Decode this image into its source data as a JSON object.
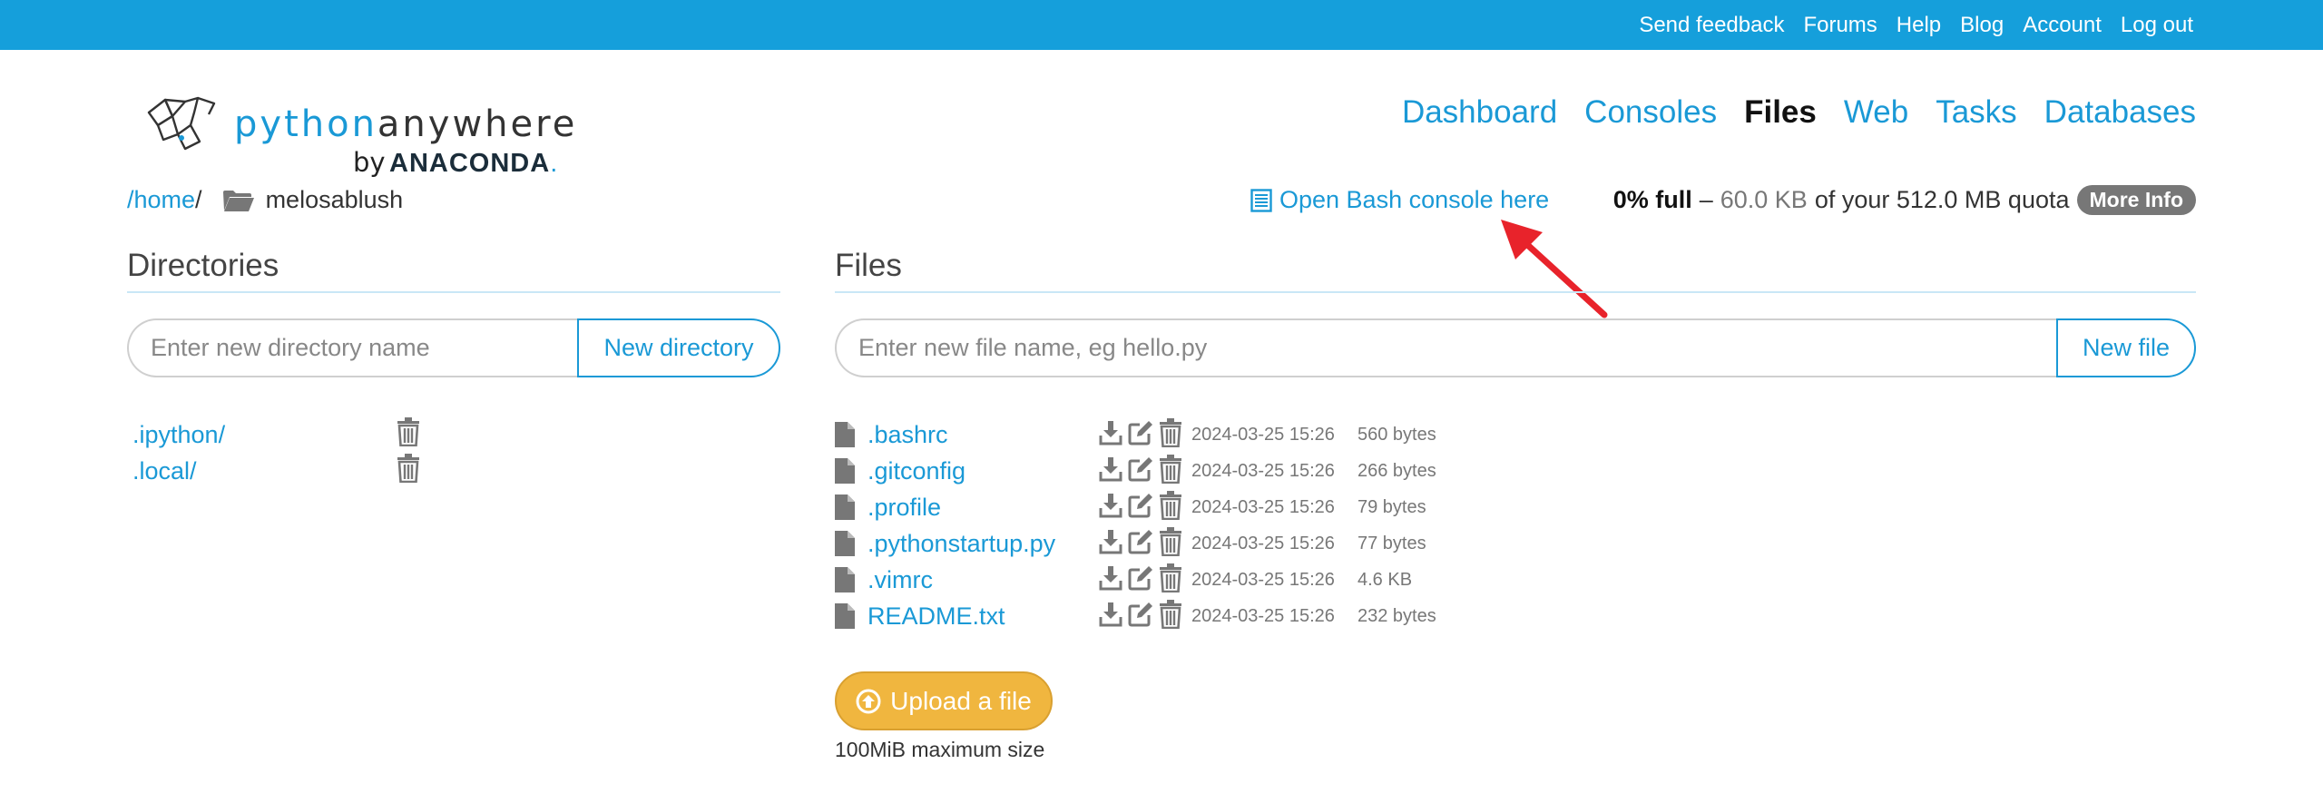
{
  "topbar": {
    "links": [
      "Send feedback",
      "Forums",
      "Help",
      "Blog",
      "Account",
      "Log out"
    ]
  },
  "logo": {
    "word_python": "python",
    "word_anywhere": "anywhere",
    "by": "by",
    "anaconda": "ANACONDA",
    "dot": "."
  },
  "nav": {
    "items": [
      "Dashboard",
      "Consoles",
      "Files",
      "Web",
      "Tasks",
      "Databases"
    ],
    "active": "Files"
  },
  "breadcrumb": {
    "home": "/home",
    "sep": "/",
    "current": "melosablush"
  },
  "bash_link": "Open Bash console here",
  "quota": {
    "percent": "0% full",
    "dash": "–",
    "used": "60.0 KB",
    "of_text": "of your 512.0 MB quota",
    "more_info": "More Info"
  },
  "directories": {
    "title": "Directories",
    "placeholder": "Enter new directory name",
    "button": "New directory",
    "items": [
      ".ipython/",
      ".local/"
    ]
  },
  "files": {
    "title": "Files",
    "placeholder": "Enter new file name, eg hello.py",
    "button": "New file",
    "items": [
      {
        "name": ".bashrc",
        "date": "2024-03-25 15:26",
        "size": "560 bytes"
      },
      {
        "name": ".gitconfig",
        "date": "2024-03-25 15:26",
        "size": "266 bytes"
      },
      {
        "name": ".profile",
        "date": "2024-03-25 15:26",
        "size": "79 bytes"
      },
      {
        "name": ".pythonstartup.py",
        "date": "2024-03-25 15:26",
        "size": "77 bytes"
      },
      {
        "name": ".vimrc",
        "date": "2024-03-25 15:26",
        "size": "4.6 KB"
      },
      {
        "name": "README.txt",
        "date": "2024-03-25 15:26",
        "size": "232 bytes"
      }
    ]
  },
  "upload": {
    "button": "Upload a file",
    "note": "100MiB maximum size"
  },
  "colors": {
    "topbar": "#159fdb",
    "link": "#1a99d6",
    "upload": "#f0b63f",
    "annotation_arrow": "#e8232b"
  }
}
